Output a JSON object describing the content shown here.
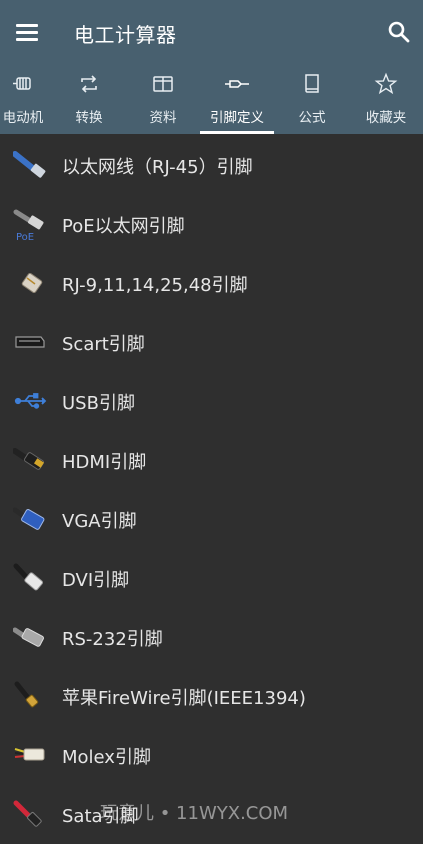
{
  "app": {
    "title": "电工计算器",
    "bar_color": "#48606f",
    "background": "#2f2f2f"
  },
  "tabs": [
    {
      "label": "电动机",
      "icon": "motor-icon"
    },
    {
      "label": "转换",
      "icon": "convert-icon"
    },
    {
      "label": "资料",
      "icon": "book-open-icon"
    },
    {
      "label": "引脚定义",
      "icon": "connector-icon",
      "active": true
    },
    {
      "label": "公式",
      "icon": "book-icon"
    },
    {
      "label": "收藏夹",
      "icon": "star-icon"
    }
  ],
  "items": [
    {
      "label": "以太网线（RJ-45）引脚",
      "icon": "ethernet-cable-icon"
    },
    {
      "label": "PoE以太网引脚",
      "icon": "poe-icon"
    },
    {
      "label": "RJ-9,11,14,25,48引脚",
      "icon": "rj-connector-icon"
    },
    {
      "label": "Scart引脚",
      "icon": "scart-icon"
    },
    {
      "label": "USB引脚",
      "icon": "usb-icon"
    },
    {
      "label": "HDMI引脚",
      "icon": "hdmi-icon"
    },
    {
      "label": "VGA引脚",
      "icon": "vga-icon"
    },
    {
      "label": "DVI引脚",
      "icon": "dvi-icon"
    },
    {
      "label": "RS-232引脚",
      "icon": "rs232-icon"
    },
    {
      "label": "苹果FireWire引脚(IEEE1394)",
      "icon": "firewire-icon"
    },
    {
      "label": "Molex引脚",
      "icon": "molex-icon"
    },
    {
      "label": "Sata引脚",
      "icon": "sata-icon"
    }
  ],
  "watermark": "玩意儿 • 11WYX.COM"
}
